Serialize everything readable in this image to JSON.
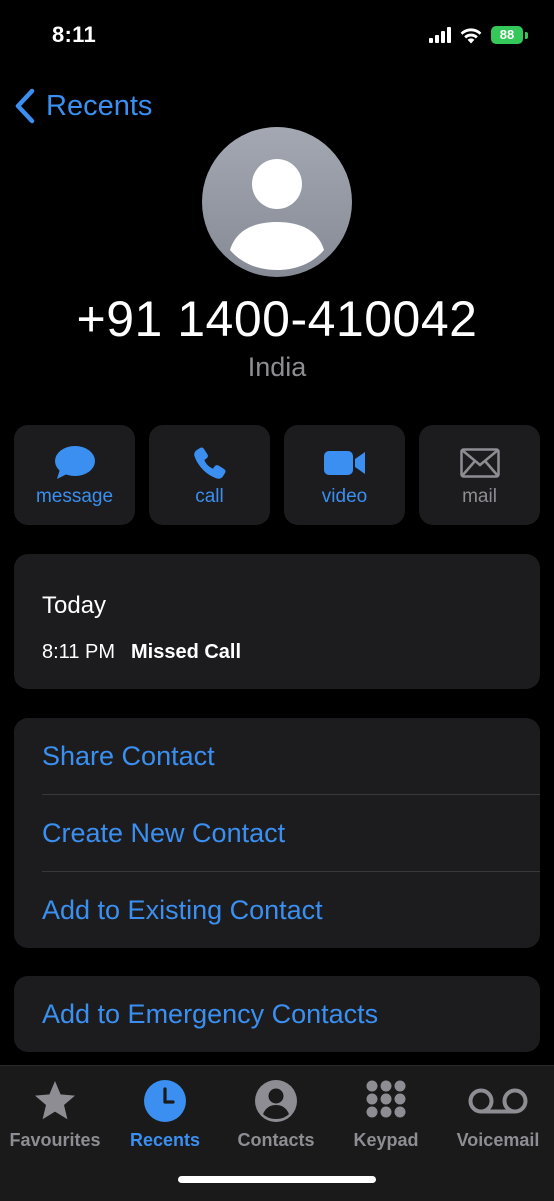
{
  "status_bar": {
    "time": "8:11",
    "battery": "88"
  },
  "nav": {
    "back_label": "Recents"
  },
  "contact": {
    "number": "+91 1400-410042",
    "country": "India"
  },
  "actions": [
    {
      "label": "message",
      "icon": "message-icon",
      "enabled": true
    },
    {
      "label": "call",
      "icon": "phone-icon",
      "enabled": true
    },
    {
      "label": "video",
      "icon": "video-icon",
      "enabled": true
    },
    {
      "label": "mail",
      "icon": "mail-icon",
      "enabled": false
    }
  ],
  "history": {
    "day": "Today",
    "time": "8:11 PM",
    "type": "Missed Call"
  },
  "options": [
    "Share Contact",
    "Create New Contact",
    "Add to Existing Contact"
  ],
  "emergency": "Add to Emergency Contacts",
  "tabs": [
    {
      "label": "Favourites",
      "icon": "star-icon",
      "active": false
    },
    {
      "label": "Recents",
      "icon": "clock-icon",
      "active": true
    },
    {
      "label": "Contacts",
      "icon": "person-circle-icon",
      "active": false
    },
    {
      "label": "Keypad",
      "icon": "keypad-icon",
      "active": false
    },
    {
      "label": "Voicemail",
      "icon": "voicemail-icon",
      "active": false
    }
  ],
  "colors": {
    "accent": "#3a8ff0",
    "background": "#000000",
    "card": "#1c1c1e",
    "secondary_text": "#8d8d93",
    "battery": "#34c759"
  }
}
